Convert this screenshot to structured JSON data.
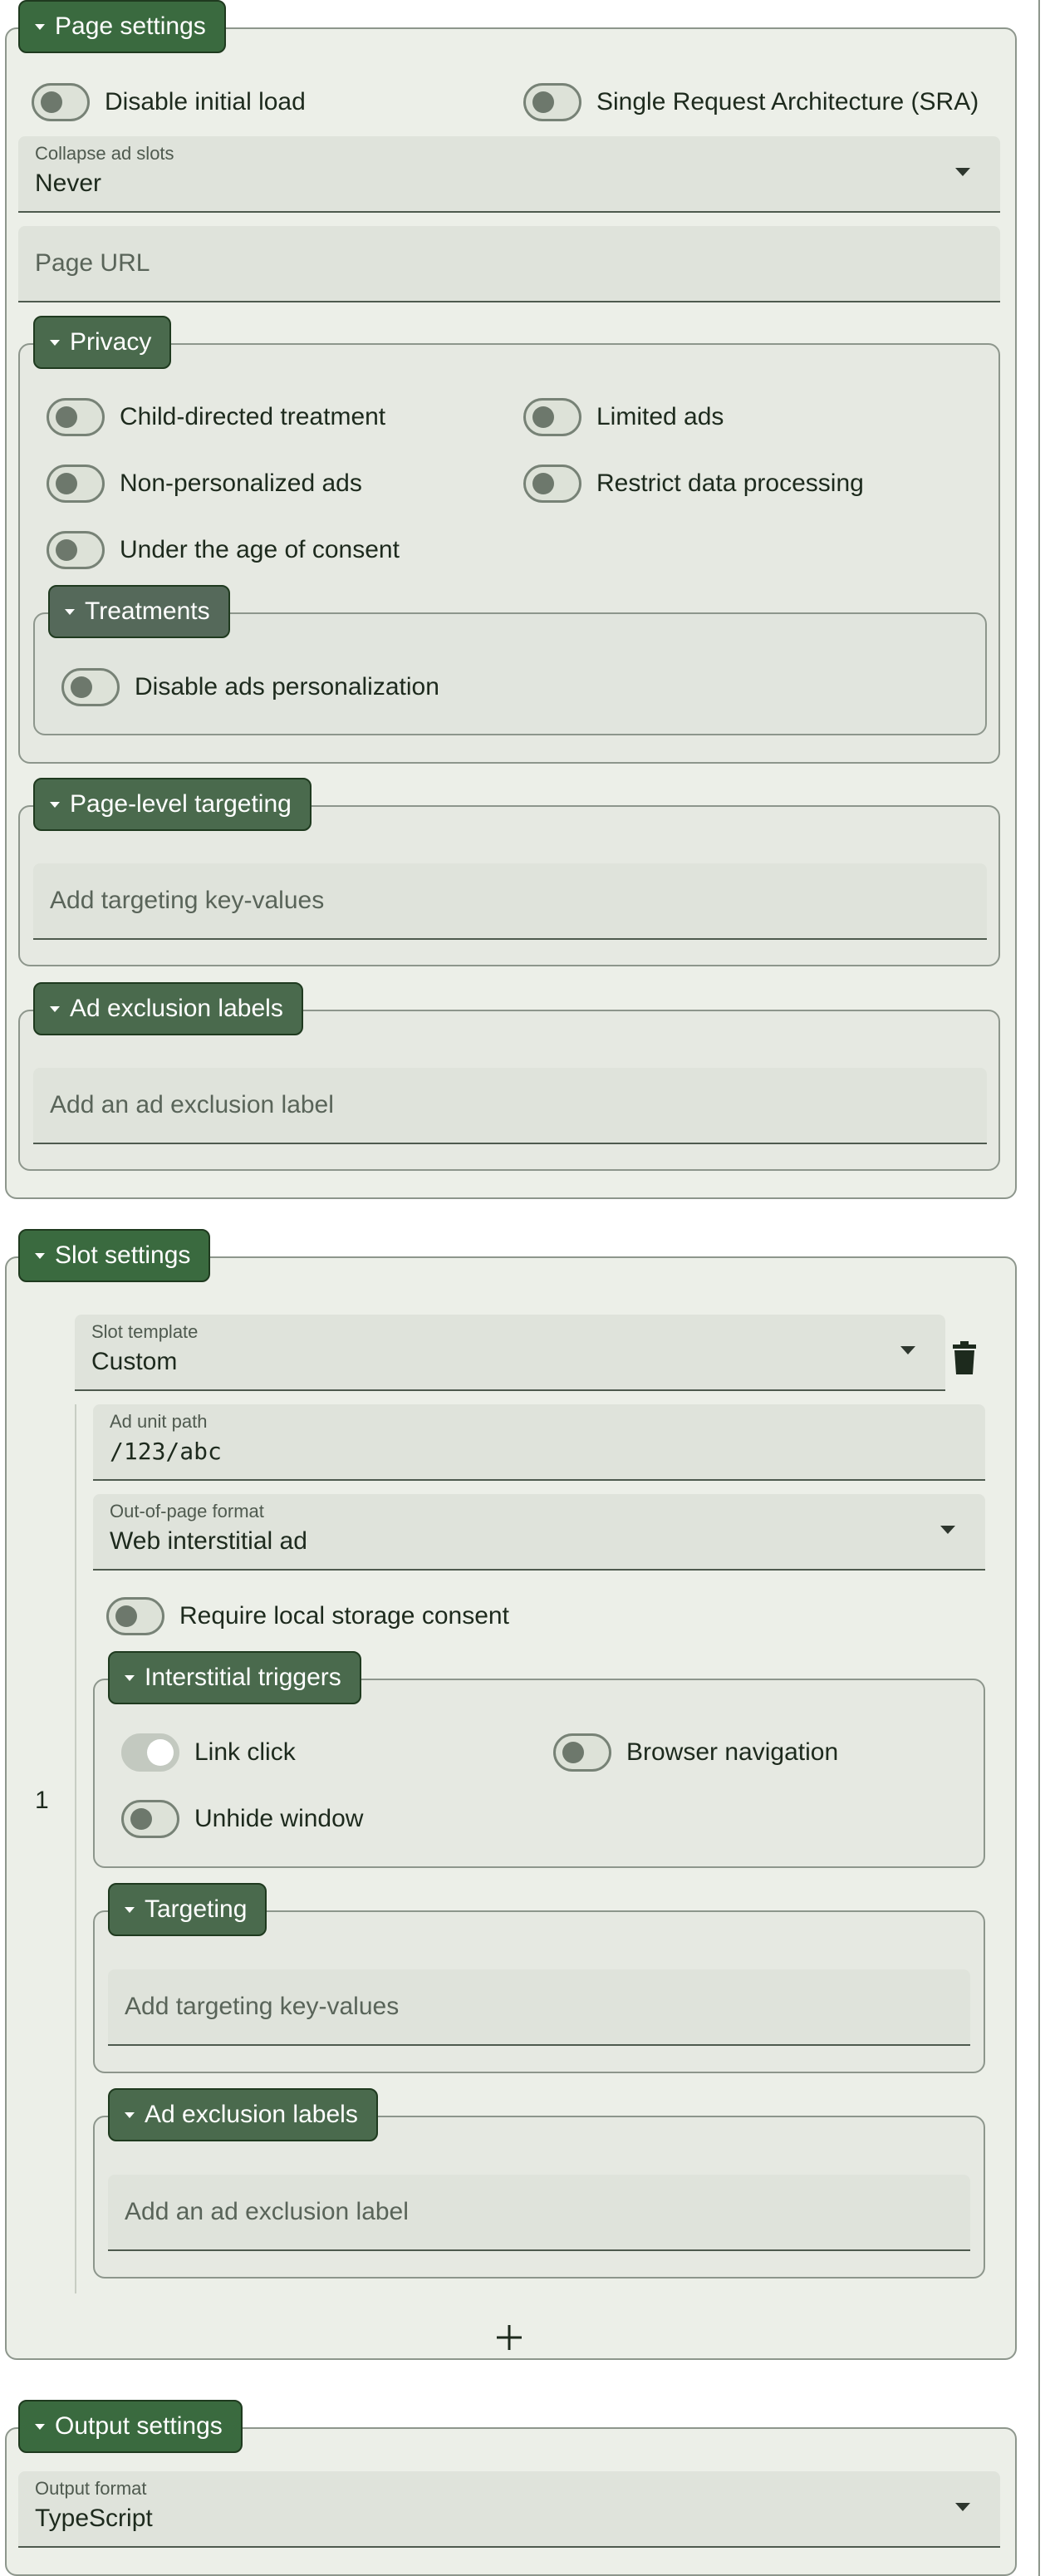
{
  "page_settings": {
    "title": "Page settings",
    "disable_initial_load": "Disable initial load",
    "sra": "Single Request Architecture (SRA)",
    "collapse": {
      "label": "Collapse ad slots",
      "value": "Never"
    },
    "page_url_placeholder": "Page URL",
    "privacy": {
      "title": "Privacy",
      "child_directed": "Child-directed treatment",
      "limited_ads": "Limited ads",
      "non_personalized": "Non-personalized ads",
      "restrict_processing": "Restrict data processing",
      "under_age": "Under the age of consent",
      "treatments": {
        "title": "Treatments",
        "disable_personalization": "Disable ads personalization"
      }
    },
    "targeting": {
      "title": "Page-level targeting",
      "placeholder": "Add targeting key-values"
    },
    "exclusions": {
      "title": "Ad exclusion labels",
      "placeholder": "Add an ad exclusion label"
    }
  },
  "slot_settings": {
    "title": "Slot settings",
    "slot_number": "1",
    "template": {
      "label": "Slot template",
      "value": "Custom"
    },
    "ad_unit": {
      "label": "Ad unit path",
      "value": "/123/abc"
    },
    "oop": {
      "label": "Out-of-page format",
      "value": "Web interstitial ad"
    },
    "local_storage": "Require local storage consent",
    "triggers": {
      "title": "Interstitial triggers",
      "link_click": "Link click",
      "browser_nav": "Browser navigation",
      "unhide": "Unhide window"
    },
    "targeting": {
      "title": "Targeting",
      "placeholder": "Add targeting key-values"
    },
    "exclusions": {
      "title": "Ad exclusion labels",
      "placeholder": "Add an ad exclusion label"
    }
  },
  "output_settings": {
    "title": "Output settings",
    "format": {
      "label": "Output format",
      "value": "TypeScript"
    }
  },
  "toggle_states": {
    "link_click": true
  }
}
